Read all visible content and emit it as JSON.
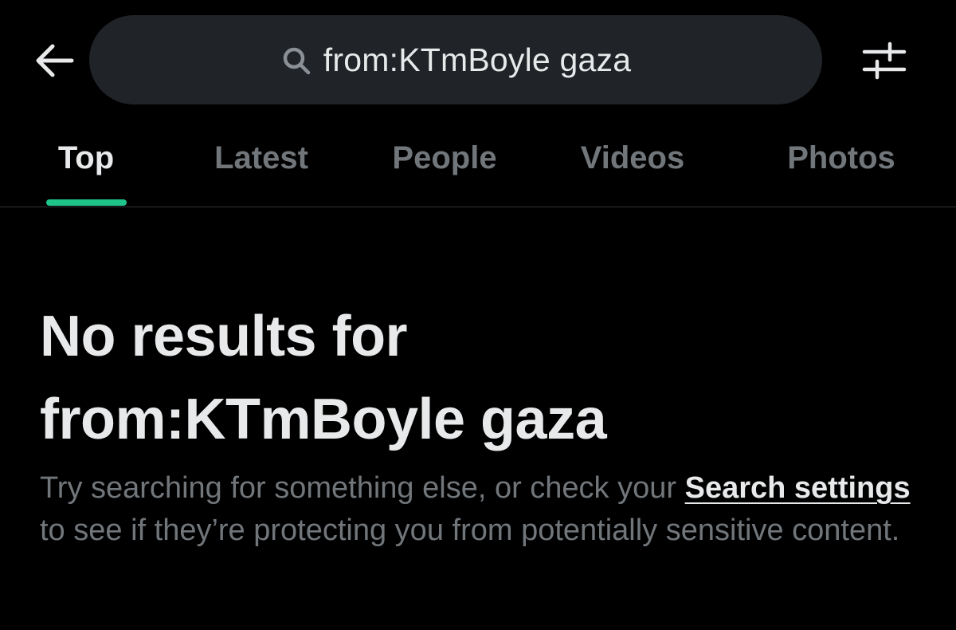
{
  "header": {
    "back_icon": "arrow-left-icon",
    "search": {
      "icon": "search-icon",
      "query": "from:KTmBoyle gaza"
    },
    "filter_icon": "sliders-icon"
  },
  "tabs": [
    {
      "label": "Top",
      "active": true
    },
    {
      "label": "Latest",
      "active": false
    },
    {
      "label": "People",
      "active": false
    },
    {
      "label": "Videos",
      "active": false
    },
    {
      "label": "Photos",
      "active": false
    }
  ],
  "empty_state": {
    "title_line1": "No results for",
    "title_line2": "from:KTmBoyle gaza",
    "body_before_link": "Try searching for something else, or check your ",
    "link_text": "Search settings",
    "body_after_link": " to see if they’re protecting you from potentially sensitive content."
  },
  "colors": {
    "background": "#000000",
    "search_pill": "#202327",
    "primary_text": "#e7e9ea",
    "secondary_text": "#71767b",
    "accent_indicator": "#1fc48a",
    "divider": "#2f3336"
  }
}
